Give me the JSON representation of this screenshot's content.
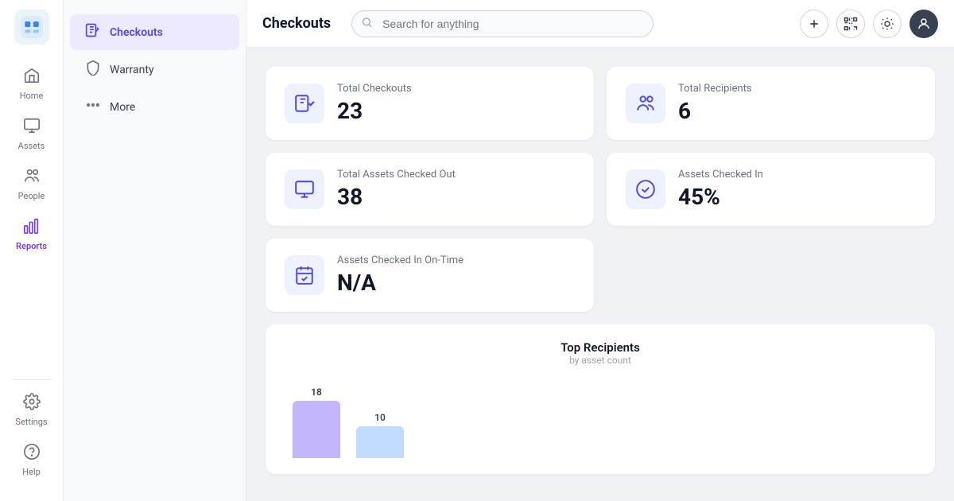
{
  "app": {
    "logo_alt": "App Logo"
  },
  "sidebar": {
    "items": [
      {
        "id": "home",
        "label": "Home",
        "icon": "🏠",
        "active": false
      },
      {
        "id": "assets",
        "label": "Assets",
        "icon": "🖥",
        "active": false
      },
      {
        "id": "people",
        "label": "People",
        "icon": "👥",
        "active": false
      },
      {
        "id": "reports",
        "label": "Reports",
        "icon": "📊",
        "active": true
      }
    ],
    "bottom_items": [
      {
        "id": "settings",
        "label": "Settings",
        "icon": "⚙️"
      },
      {
        "id": "help",
        "label": "Help",
        "icon": "❓"
      }
    ]
  },
  "secondary_sidebar": {
    "items": [
      {
        "id": "checkouts",
        "label": "Checkouts",
        "active": true
      },
      {
        "id": "warranty",
        "label": "Warranty",
        "active": false
      },
      {
        "id": "more",
        "label": "More",
        "active": false
      }
    ]
  },
  "topbar": {
    "title": "Checkouts",
    "search_placeholder": "Search for anything"
  },
  "stats": [
    {
      "id": "total-checkouts",
      "label": "Total Checkouts",
      "value": "23",
      "icon": "checkouts"
    },
    {
      "id": "total-recipients",
      "label": "Total Recipients",
      "value": "6",
      "icon": "recipients"
    },
    {
      "id": "total-assets-checked-out",
      "label": "Total Assets Checked Out",
      "value": "38",
      "icon": "assets"
    },
    {
      "id": "assets-checked-in",
      "label": "Assets Checked In",
      "value": "45%",
      "icon": "check"
    }
  ],
  "single_stat": {
    "id": "assets-checked-in-ontime",
    "label": "Assets Checked In On-Time",
    "value": "N/A",
    "icon": "calendar-check"
  },
  "chart": {
    "title": "Top Recipients",
    "subtitle": "by asset count",
    "bars": [
      {
        "label": "18",
        "height": 72,
        "color": "#c4b5fd"
      },
      {
        "label": "10",
        "height": 40,
        "color": "#bfdbfe"
      }
    ]
  }
}
